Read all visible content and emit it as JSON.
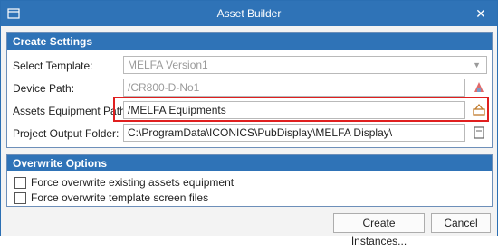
{
  "window": {
    "title": "Asset Builder",
    "close_glyph": "✕"
  },
  "create_settings": {
    "header": "Create Settings",
    "rows": [
      {
        "label": "Select Template:",
        "value": "MELFA Version1",
        "disabled": true
      },
      {
        "label": "Device Path:",
        "value": "/CR800-D-No1",
        "disabled": true
      },
      {
        "label": "Assets Equipment Path:",
        "value": "/MELFA Equipments"
      },
      {
        "label": "Project Output Folder:",
        "value": "C:\\ProgramData\\ICONICS\\PubDisplay\\MELFA Display\\"
      }
    ],
    "icons": [
      "device-browse-icon",
      "equipment-browse-icon",
      "folder-browse-icon"
    ]
  },
  "overwrite_options": {
    "header": "Overwrite Options",
    "options": [
      {
        "label": "Force overwrite existing assets equipment",
        "checked": false
      },
      {
        "label": "Force overwrite template screen files",
        "checked": false
      }
    ]
  },
  "buttons": {
    "create": "Create Instances...",
    "cancel": "Cancel"
  },
  "colors": {
    "accent": "#2f73b7",
    "highlight": "#e01f1f"
  }
}
